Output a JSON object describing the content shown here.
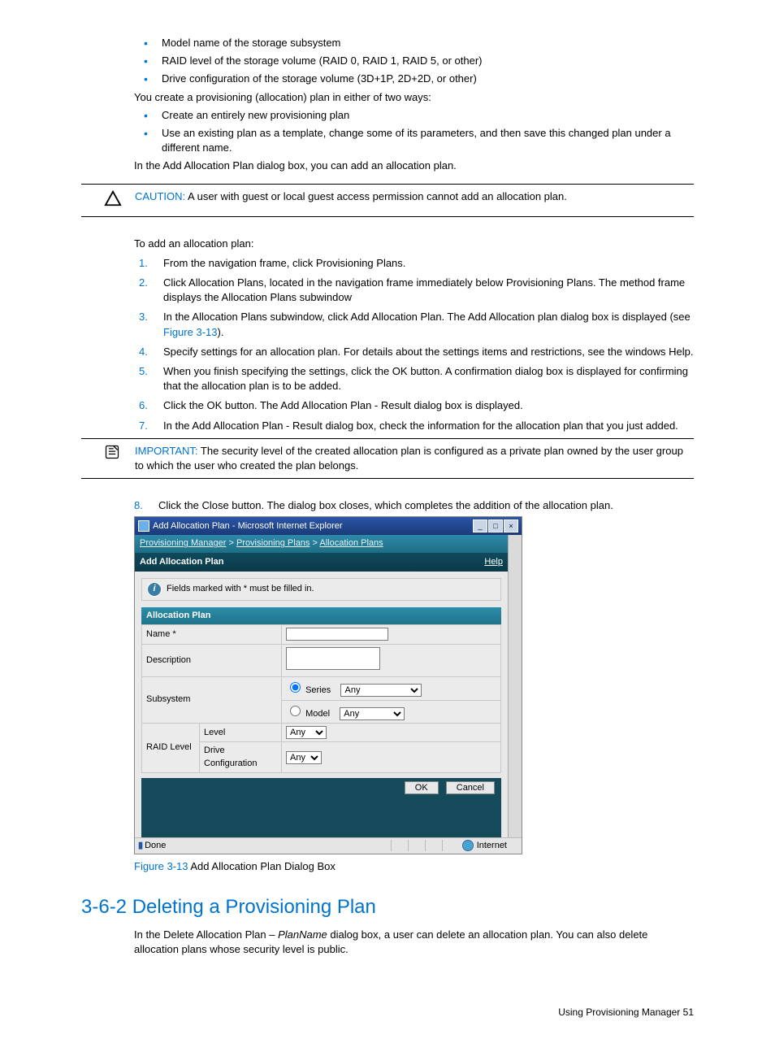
{
  "bullets_top": [
    "Model name of the storage subsystem",
    "RAID level of the storage volume (RAID 0, RAID 1, RAID 5, or other)",
    "Drive configuration of the storage volume (3D+1P, 2D+2D, or other)"
  ],
  "para_create": "You create a provisioning (allocation) plan in either of two ways:",
  "bullets_ways": [
    "Create an entirely new provisioning plan",
    "Use an existing plan as a template, change some of its parameters, and then save this changed plan under a different name."
  ],
  "para_add": "In the Add Allocation Plan dialog box, you can add an allocation plan.",
  "caution": {
    "label": "CAUTION:",
    "text": "  A user with guest or local guest access permission cannot add an allocation plan."
  },
  "para_toadd": "To add an allocation plan:",
  "steps": [
    "From the navigation frame, click Provisioning Plans.",
    "Click Allocation Plans, located in the navigation frame immediately below Provisioning Plans. The method frame displays the Allocation Plans subwindow",
    {
      "pre": "In the Allocation Plans subwindow, click Add Allocation Plan. The Add Allocation plan dialog box is displayed (see ",
      "link": "Figure 3-13",
      "post": ")."
    },
    "Specify settings for an allocation plan. For details about the settings items and restrictions, see the windows Help.",
    "When you finish specifying the settings, click the OK button. A confirmation dialog box is displayed for confirming that the allocation plan is to be added.",
    "Click the OK button. The Add Allocation Plan - Result dialog box is displayed.",
    "In the Add Allocation Plan - Result dialog box, check the information for the allocation plan that you just added."
  ],
  "important": {
    "label": "IMPORTANT:",
    "text": "  The security level of the created allocation plan is configured as a private plan owned by the user group to which the user who created the plan belongs."
  },
  "step8_num": "8.",
  "step8": "Click the Close button. The dialog box closes, which completes the addition of the allocation plan.",
  "dialog": {
    "titlebar": "Add Allocation Plan - Microsoft Internet Explorer",
    "breadcrumb": {
      "a": "Provisioning Manager",
      "sep": " > ",
      "b": "Provisioning Plans",
      "c": "Allocation Plans"
    },
    "header": "Add Allocation Plan",
    "help": "Help",
    "info": "Fields marked with * must be filled in.",
    "section": "Allocation Plan",
    "rows": {
      "name": "Name *",
      "desc": "Description",
      "subsys": "Subsystem",
      "series": "Series",
      "model": "Model",
      "raid": "RAID Level",
      "level": "Level",
      "drive": "Drive Configuration",
      "any": "Any"
    },
    "ok": "OK",
    "cancel": "Cancel",
    "status_done": "Done",
    "status_zone": "Internet"
  },
  "figure": {
    "label": "Figure 3-13",
    "caption": " Add Allocation Plan Dialog Box"
  },
  "h2": "3-6-2 Deleting a Provisioning Plan",
  "delete_para": {
    "pre": "In the Delete Allocation Plan – ",
    "em": "PlanName",
    "post": " dialog box, a user can delete an allocation plan. You can also delete allocation plans whose security level is public."
  },
  "footer": {
    "text": "Using Provisioning Manager  ",
    "page": "51"
  }
}
